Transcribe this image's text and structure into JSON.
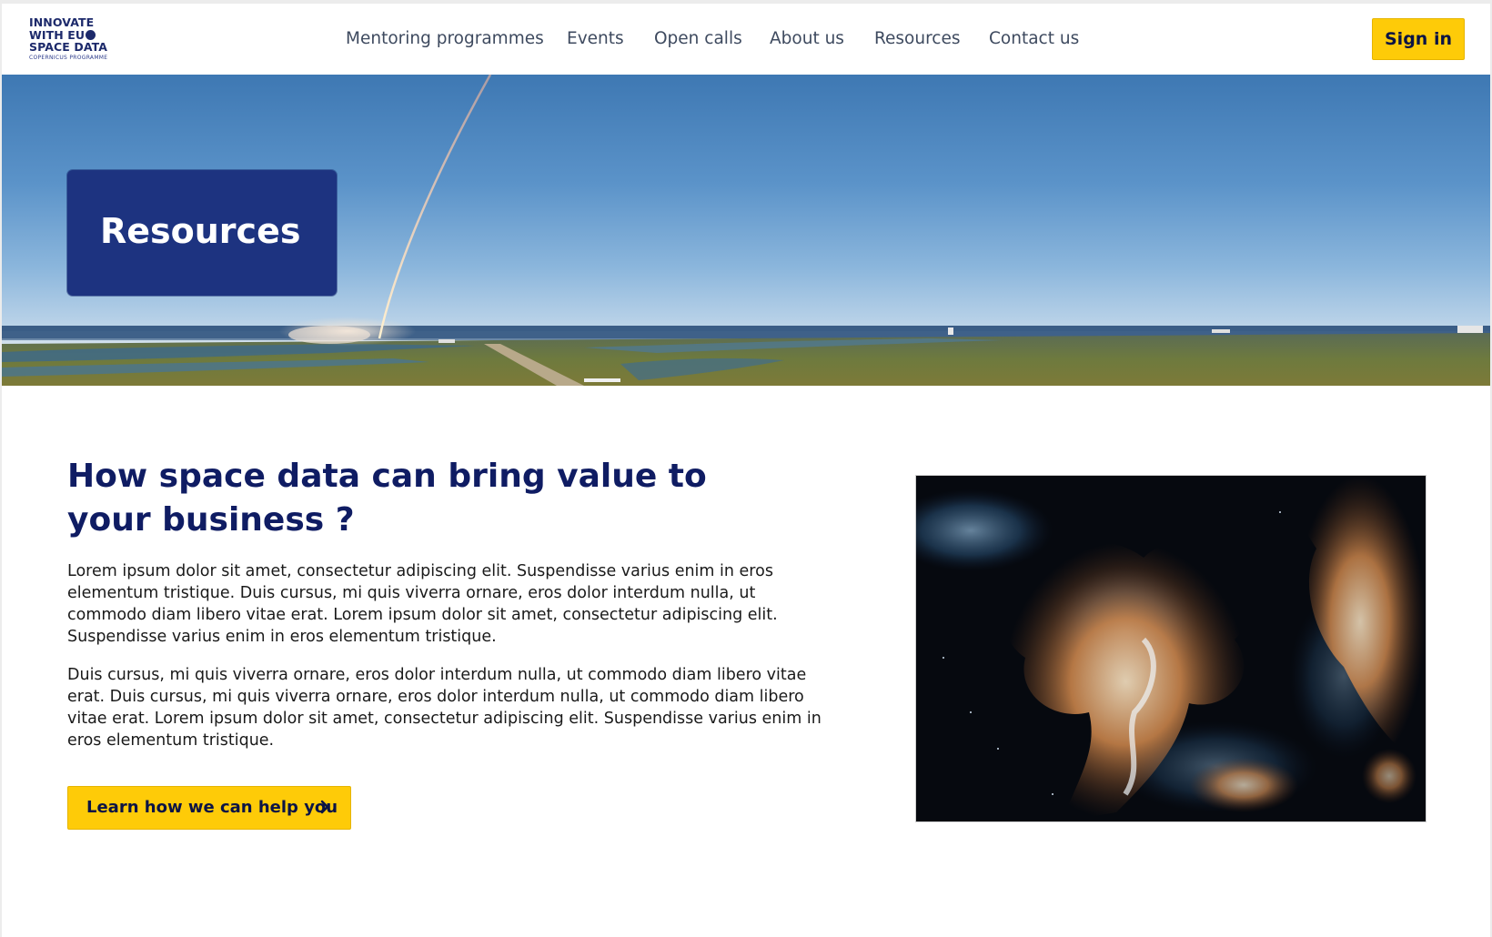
{
  "brand": {
    "logo_line1": "INNOVATE",
    "logo_line2": "WITH EU",
    "logo_line3": "SPACE DATA",
    "logo_line4": "COPERNICUS PROGRAMME",
    "primary_color": "#0f1c63",
    "accent_color": "#fecb08"
  },
  "nav": {
    "items": [
      {
        "label": "Mentoring programmes"
      },
      {
        "label": "Events"
      },
      {
        "label": "Open calls"
      },
      {
        "label": "About us"
      },
      {
        "label": "Resources"
      },
      {
        "label": "Contact us"
      }
    ],
    "signin_label": "Sign in"
  },
  "hero": {
    "title": "Resources"
  },
  "main": {
    "headline": "How space data can bring value to your business ?",
    "paragraph1": "Lorem ipsum dolor sit amet, consectetur adipiscing elit. Suspendisse varius enim in eros elementum tristique. Duis cursus, mi quis viverra ornare, eros dolor interdum nulla, ut commodo diam libero vitae erat. Lorem ipsum dolor sit amet, consectetur adipiscing elit. Suspendisse varius enim in eros elementum tristique.",
    "paragraph2": "Duis cursus, mi quis viverra ornare, eros dolor interdum nulla, ut commodo diam libero vitae erat. Duis cursus, mi quis viverra ornare, eros dolor interdum nulla, ut commodo diam libero vitae erat. Lorem ipsum dolor sit amet, consectetur adipiscing elit. Suspendisse varius enim in eros elementum tristique.",
    "cta_label": "Learn how we can help you",
    "cta_icon": "chevron-right-icon"
  }
}
